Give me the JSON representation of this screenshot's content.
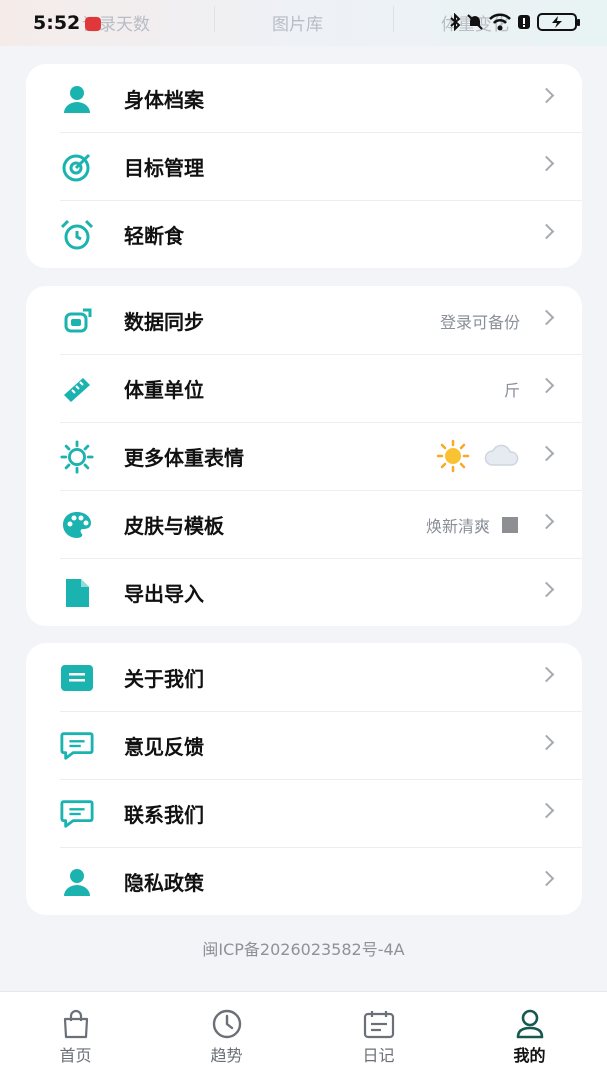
{
  "status_bar": {
    "time": "5:52"
  },
  "header_tabs": [
    "记录天数",
    "图片库",
    "体重变化"
  ],
  "colors": {
    "accent": "#1bb3b0",
    "background": "#f3f4f7",
    "active_tab": "#17594f"
  },
  "sections": [
    {
      "items": [
        {
          "label": "身体档案",
          "icon": "person-icon"
        },
        {
          "label": "目标管理",
          "icon": "target-icon"
        },
        {
          "label": "轻断食",
          "icon": "alarm-clock-icon"
        }
      ]
    },
    {
      "items": [
        {
          "label": "数据同步",
          "value": "登录可备份",
          "icon": "sync-icon"
        },
        {
          "label": "体重单位",
          "value": "斤",
          "icon": "ruler-icon"
        },
        {
          "label": "更多体重表情",
          "icon": "sun-icon"
        },
        {
          "label": "皮肤与模板",
          "value": "焕新清爽",
          "icon": "palette-icon"
        },
        {
          "label": "导出导入",
          "icon": "file-icon"
        }
      ]
    },
    {
      "items": [
        {
          "label": "关于我们",
          "icon": "info-card-icon"
        },
        {
          "label": "意见反馈",
          "icon": "chat-icon"
        },
        {
          "label": "联系我们",
          "icon": "chat-icon"
        },
        {
          "label": "隐私政策",
          "icon": "person-icon"
        }
      ]
    }
  ],
  "icp": "闽ICP备2026023582号-4A",
  "tabbar": [
    {
      "label": "首页",
      "icon": "bag-icon"
    },
    {
      "label": "趋势",
      "icon": "clock-icon"
    },
    {
      "label": "日记",
      "icon": "calendar-icon"
    },
    {
      "label": "我的",
      "icon": "profile-icon",
      "active": true
    }
  ]
}
